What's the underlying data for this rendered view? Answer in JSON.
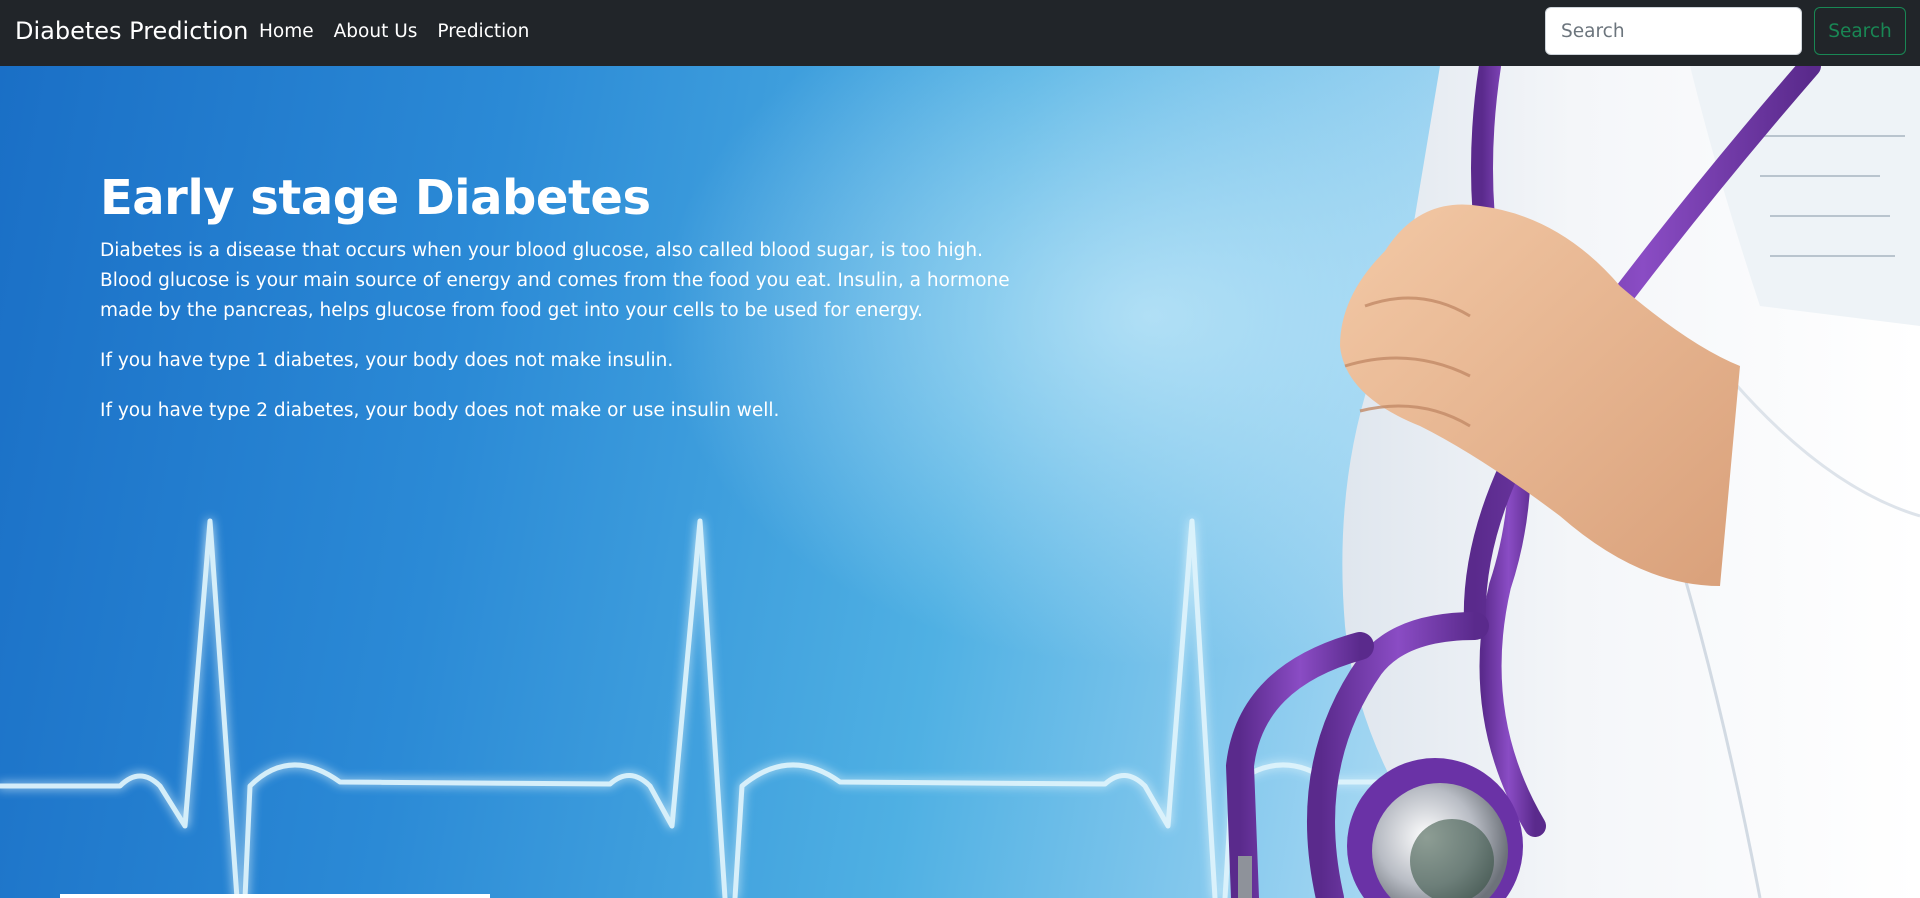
{
  "navbar": {
    "brand": "Diabetes Prediction",
    "links": [
      "Home",
      "About Us",
      "Prediction"
    ],
    "search_placeholder": "Search",
    "search_button": "Search"
  },
  "hero": {
    "title": "Early stage Diabetes",
    "paragraphs": [
      "Diabetes is a disease that occurs when your blood glucose, also called blood sugar, is too high. Blood glucose is your main source of energy and comes from the food you eat. Insulin, a hormone made by the pancreas, helps glucose from food get into your cells to be used for energy.",
      "If you have type 1 diabetes, your body does not make insulin.",
      "If you have type 2 diabetes, your body does not make or use insulin well."
    ]
  },
  "colors": {
    "navbar_bg": "#212529",
    "search_button": "#198754",
    "stethoscope": "#7a3fb0"
  },
  "icons": {
    "background_image": "doctor-with-stethoscope-and-heartbeat-line"
  }
}
